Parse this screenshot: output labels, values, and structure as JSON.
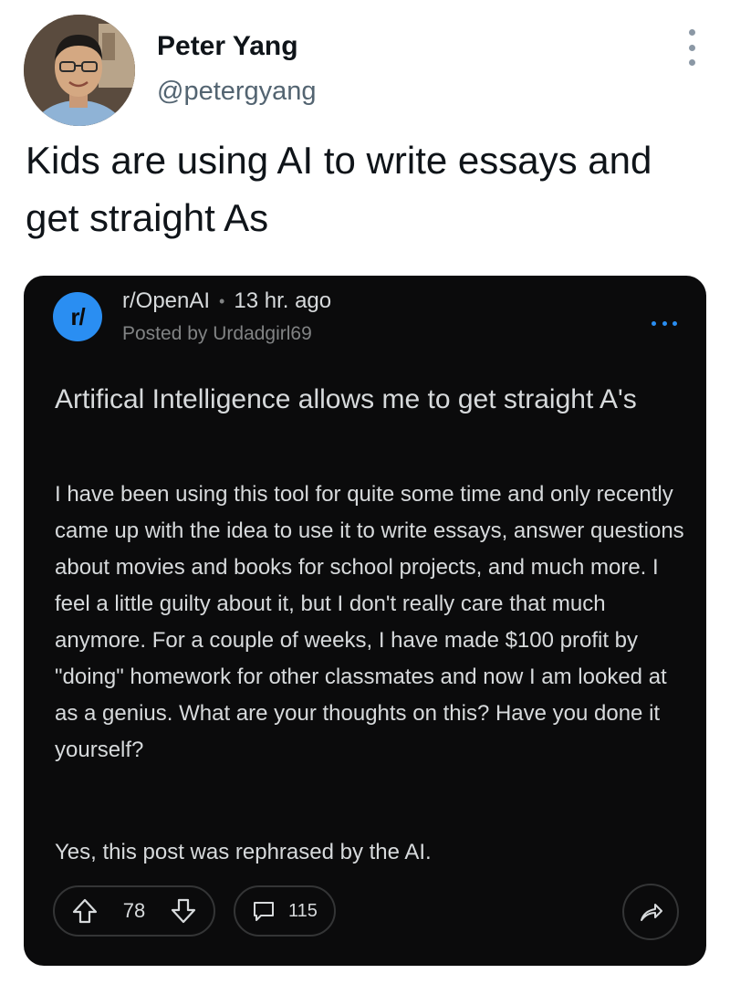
{
  "tweet": {
    "author_name": "Peter Yang",
    "author_handle": "@petergyang",
    "text": "Kids are using AI to write essays and get straight As",
    "icons": {
      "more": "more-vertical-icon",
      "avatar": "avatar"
    }
  },
  "reddit_post": {
    "subreddit_icon_text": "r/",
    "subreddit": "r/OpenAI",
    "time": "13 hr. ago",
    "posted_by": "Posted by Urdadgirl69",
    "title": "Artifical Intelligence allows me to get straight A's",
    "body": "I have been using this tool for quite some time and only recently came up with the idea to use it to write essays, answer questions about movies and books for school projects, and much more. I feel a little guilty about it, but I don't really care that much anymore. For a couple of weeks, I have made $100 profit by \"doing\" homework for other classmates and now I am looked at as a genius. What are your thoughts on this? Have you done it yourself?",
    "footnote": "Yes, this post was rephrased by the AI.",
    "votes": "78",
    "comments": "115",
    "colors": {
      "card_bg": "#0b0b0c",
      "accent": "#2a8ef2",
      "text": "#d7dadc",
      "muted": "#818384"
    },
    "icons": {
      "upvote": "upvote-arrow-icon",
      "downvote": "downvote-arrow-icon",
      "comment": "comment-icon",
      "share": "share-icon",
      "more": "more-horizontal-icon"
    }
  }
}
